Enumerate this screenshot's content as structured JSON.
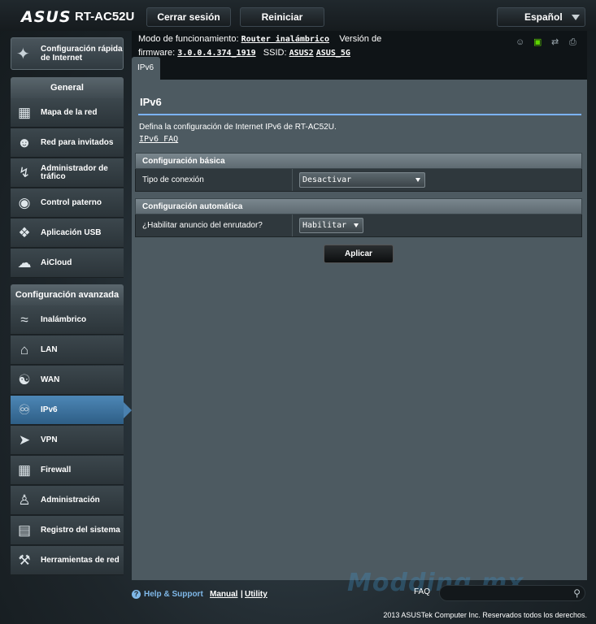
{
  "header": {
    "logo": "ASUS",
    "model": "RT-AC52U",
    "logout_label": "Cerrar sesión",
    "reboot_label": "Reiniciar",
    "language": "Español"
  },
  "info": {
    "mode_label": "Modo de funcionamiento:",
    "mode_value": "Router inalámbrico",
    "fw_label1": "Versión de",
    "fw_label2": "firmware:",
    "fw_value": "3.0.0.4.374_1919",
    "ssid_label": "SSID:",
    "ssid1": "ASUS2",
    "ssid2": "ASUS_5G",
    "status_icons": [
      "users-icon",
      "network-icon",
      "usb-icon",
      "printer-icon"
    ]
  },
  "tab": "IPv6",
  "sidebar": {
    "quick_setup": "Configuración rápida de Internet",
    "general_header": "General",
    "general_items": [
      {
        "label": "Mapa de la red",
        "icon": "network-map-icon"
      },
      {
        "label": "Red para invitados",
        "icon": "guest-network-icon"
      },
      {
        "label": "Administrador de tráfico",
        "icon": "traffic-manager-icon"
      },
      {
        "label": "Control paterno",
        "icon": "parental-control-icon"
      },
      {
        "label": "Aplicación USB",
        "icon": "usb-app-icon"
      },
      {
        "label": "AiCloud",
        "icon": "aicloud-icon"
      }
    ],
    "advanced_header": "Configuración avanzada",
    "advanced_items": [
      {
        "label": "Inalámbrico",
        "icon": "wireless-icon"
      },
      {
        "label": "LAN",
        "icon": "lan-icon"
      },
      {
        "label": "WAN",
        "icon": "wan-icon"
      },
      {
        "label": "IPv6",
        "icon": "ipv6-icon",
        "active": true
      },
      {
        "label": "VPN",
        "icon": "vpn-icon"
      },
      {
        "label": "Firewall",
        "icon": "firewall-icon"
      },
      {
        "label": "Administración",
        "icon": "administration-icon"
      },
      {
        "label": "Registro del sistema",
        "icon": "system-log-icon"
      },
      {
        "label": "Herramientas de red",
        "icon": "network-tools-icon"
      }
    ]
  },
  "main": {
    "title": "IPv6",
    "description": "Defina la configuración de Internet IPv6 de RT-AC52U.",
    "faq_link": "IPv6 FAQ",
    "basic_header": "Configuración básica",
    "connection_type_label": "Tipo de conexión",
    "connection_type_value": "Desactivar",
    "auto_header": "Configuración automática",
    "router_adv_label": "¿Habilitar anuncio del enrutador?",
    "router_adv_value": "Habilitar",
    "apply_label": "Aplicar"
  },
  "footer": {
    "help_support": "Help & Support",
    "manual": "Manual",
    "pipe": "|",
    "utility": "Utility",
    "faq": "FAQ",
    "watermark": "Modding mx",
    "copyright": "2013 ASUSTek Computer Inc. Reservados todos los derechos."
  }
}
